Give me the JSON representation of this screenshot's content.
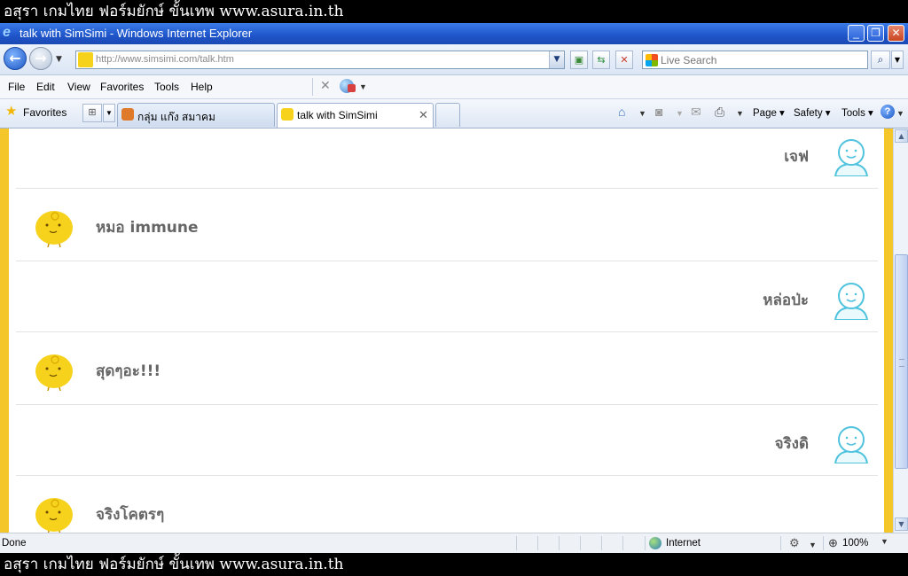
{
  "banner": {
    "text": "อสุรา เกมไทย ฟอร์มยักษ์ ขั้นเทพ www.asura.in.th"
  },
  "window": {
    "title": "talk with SimSimi - Windows Internet Explorer"
  },
  "address": {
    "url": "http://www.simsimi.com/talk.htm"
  },
  "search": {
    "placeholder": "Live Search"
  },
  "menu": {
    "items": [
      "File",
      "Edit",
      "View",
      "Favorites",
      "Tools",
      "Help"
    ]
  },
  "favorites_bar": {
    "label": "Favorites"
  },
  "tabs": [
    {
      "label": "กลุ่ม แก๊ง สมาคม",
      "active": false
    },
    {
      "label": "talk with SimSimi",
      "active": true
    }
  ],
  "command_bar": {
    "page": "Page",
    "safety": "Safety",
    "tools": "Tools"
  },
  "chat": {
    "messages": [
      {
        "sender": "user",
        "text": "เจฟ"
      },
      {
        "sender": "simsimi",
        "text": "หมอ immune"
      },
      {
        "sender": "user",
        "text": "หล่อป่ะ"
      },
      {
        "sender": "simsimi",
        "text": "สุดๆอะ!!!"
      },
      {
        "sender": "user",
        "text": "จริงดิ"
      },
      {
        "sender": "simsimi",
        "text": "จริงโคตรๆ"
      }
    ]
  },
  "status": {
    "text": "Done",
    "zone": "Internet",
    "zoom": "100%"
  },
  "colors": {
    "accent_yellow": "#f4c62a",
    "user_avatar": "#4fc3de",
    "bot_avatar": "#f6d21c",
    "title_bar": "#1f55c9"
  },
  "scroll": {
    "position_fraction": 0.44
  }
}
